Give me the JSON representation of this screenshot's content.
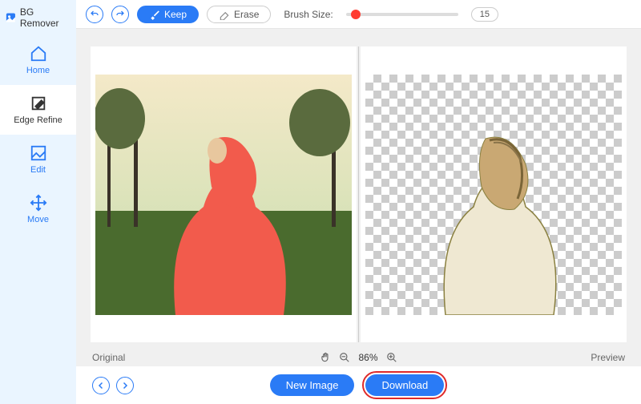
{
  "app": {
    "title": "BG Remover"
  },
  "sidebar": {
    "items": [
      {
        "label": "Home"
      },
      {
        "label": "Edge Refine"
      },
      {
        "label": "Edit"
      },
      {
        "label": "Move"
      }
    ]
  },
  "toolbar": {
    "keep_label": "Keep",
    "erase_label": "Erase",
    "brush_label": "Brush Size:",
    "brush_value": "15"
  },
  "status": {
    "original_label": "Original",
    "preview_label": "Preview",
    "zoom_label": "86%"
  },
  "bottom": {
    "new_image_label": "New Image",
    "download_label": "Download"
  }
}
